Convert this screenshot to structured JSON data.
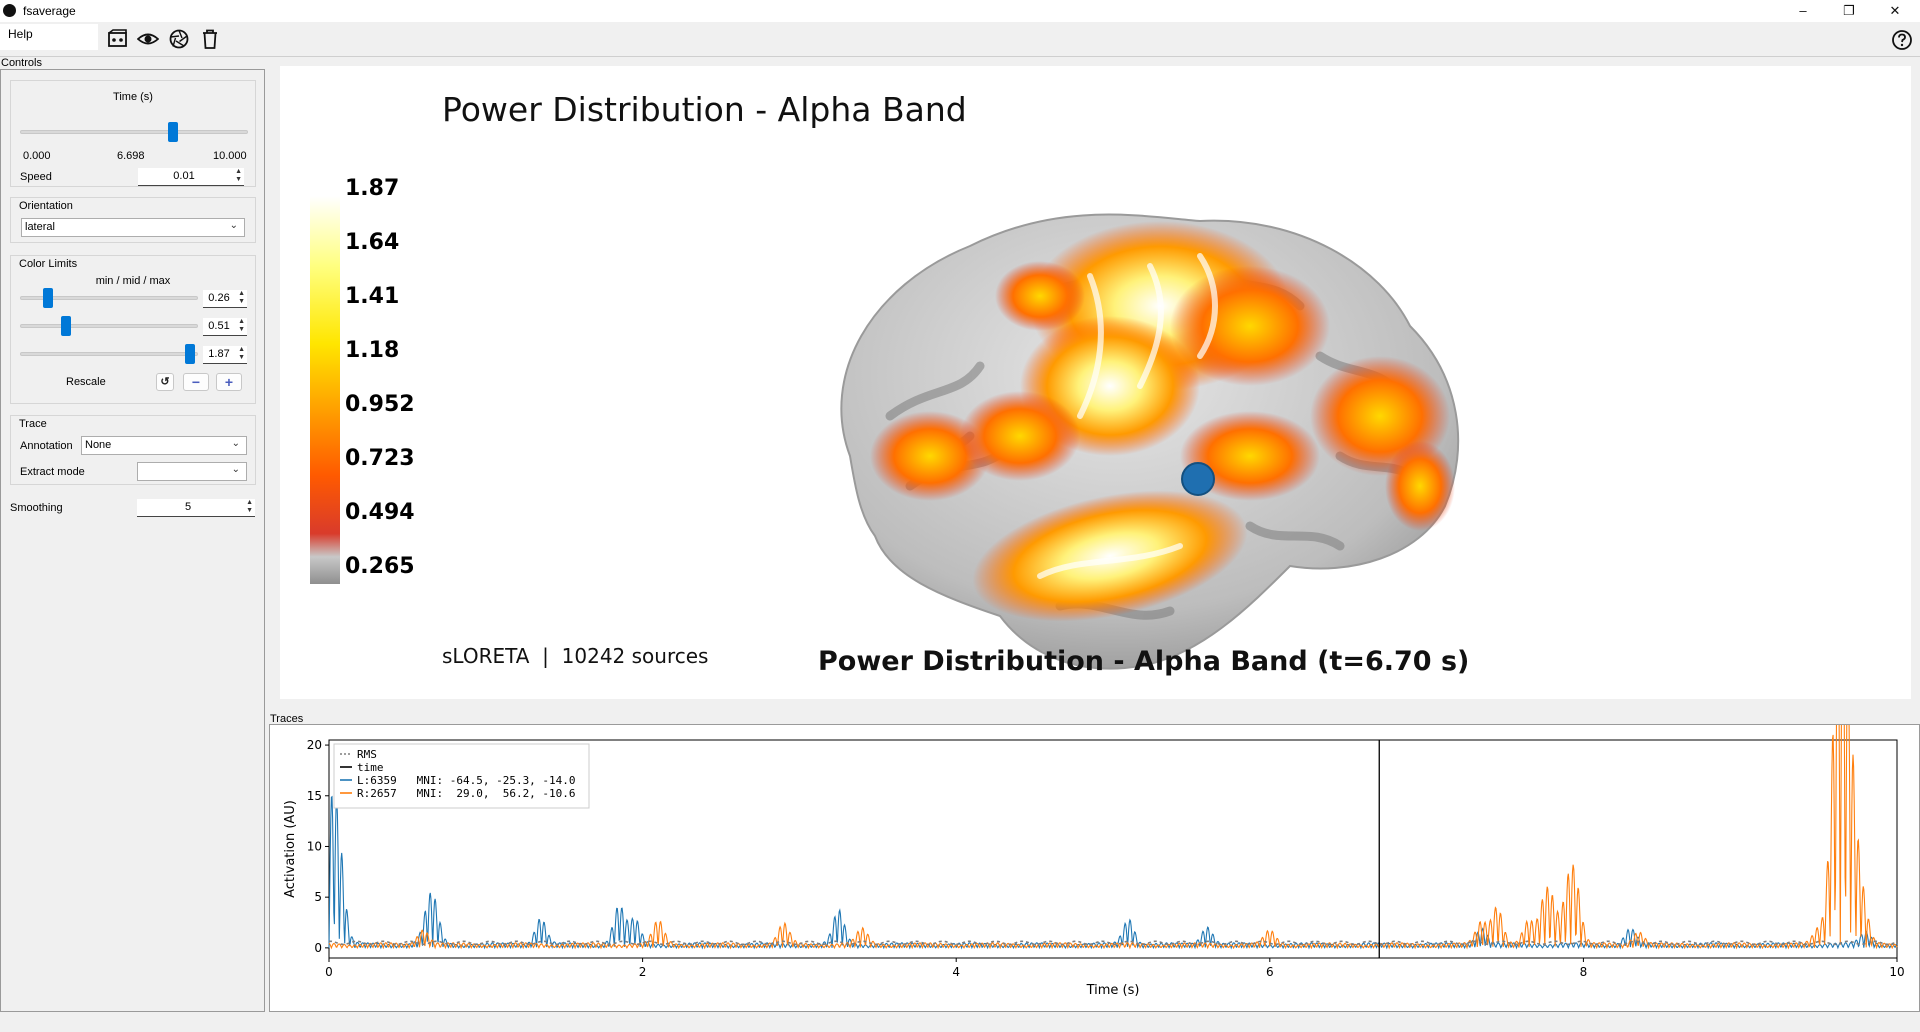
{
  "window": {
    "title": "fsaverage",
    "minimize": "–",
    "restore": "❐",
    "close": "✕"
  },
  "menu": {
    "help": "Help"
  },
  "toolbar": {
    "icons": [
      "movie-icon",
      "eye-icon",
      "camera-shutter-icon",
      "trash-icon",
      "help-circle-icon"
    ]
  },
  "controls": {
    "dock_title": "Controls",
    "time": {
      "label": "Time (s)",
      "min": "0.000",
      "current": "6.698",
      "max": "10.000",
      "fraction": 0.6698
    },
    "speed": {
      "label": "Speed",
      "value": "0.01"
    },
    "orientation": {
      "label": "Orientation",
      "value": "lateral"
    },
    "color_limits": {
      "label": "Color Limits",
      "sublabel": "min / mid / max",
      "min": "0.26",
      "mid": "0.51",
      "max": "1.87",
      "rescale_label": "Rescale",
      "reset_glyph": "↺",
      "minus_glyph": "−",
      "plus_glyph": "+"
    },
    "trace": {
      "label": "Trace",
      "annotation_label": "Annotation",
      "annotation_value": "None",
      "extract_label": "Extract mode",
      "extract_value": ""
    },
    "smoothing": {
      "label": "Smoothing",
      "value": "5"
    }
  },
  "view": {
    "title": "Power Distribution - Alpha Band",
    "colorbar_labels": [
      "1.87",
      "1.64",
      "1.41",
      "1.18",
      "0.952",
      "0.723",
      "0.494",
      "0.265"
    ],
    "footer_left": "sLORETA  |  10242 sources",
    "footer_center": "Power Distribution - Alpha Band (t=6.70 s)",
    "colors": {
      "accent": "#0078d7",
      "marker": "#1f6fb0"
    }
  },
  "traces": {
    "dock_title": "Traces"
  },
  "chart_data": {
    "type": "line",
    "xlabel": "Time (s)",
    "ylabel": "Activation (AU)",
    "xlim": [
      0,
      10
    ],
    "ylim": [
      -1,
      20.5
    ],
    "xticks": [
      "0",
      "2",
      "4",
      "6",
      "8",
      "10"
    ],
    "yticks": [
      "0",
      "5",
      "10",
      "15",
      "20"
    ],
    "time_marker": 6.698,
    "legend": [
      "RMS",
      "time",
      "L:6359   MNI: -64.5, -25.3, -14.0",
      "R:2657   MNI:  29.0,  56.2, -10.6"
    ],
    "series": [
      {
        "name": "L:6359   MNI: -64.5, -25.3, -14.0",
        "color": "#1f77b4",
        "peaks": [
          [
            0.02,
            12.8
          ],
          [
            0.07,
            6.5
          ],
          [
            0.63,
            2.5
          ],
          [
            0.67,
            3.4
          ],
          [
            1.35,
            2.6
          ],
          [
            1.85,
            3.8
          ],
          [
            1.95,
            2.4
          ],
          [
            3.25,
            3.3
          ],
          [
            5.1,
            2.5
          ],
          [
            5.6,
            1.8
          ],
          [
            7.35,
            1.6
          ],
          [
            8.3,
            1.5
          ],
          [
            9.8,
            1.2
          ]
        ]
      },
      {
        "name": "R:2657   MNI:  29.0,  56.2, -10.6",
        "color": "#ff7f0e",
        "peaks": [
          [
            0.6,
            1.5
          ],
          [
            2.1,
            2.3
          ],
          [
            2.9,
            2.0
          ],
          [
            3.4,
            1.5
          ],
          [
            6.0,
            1.3
          ],
          [
            7.35,
            2.2
          ],
          [
            7.45,
            3.8
          ],
          [
            7.65,
            2.2
          ],
          [
            7.75,
            3.7
          ],
          [
            7.8,
            3.5
          ],
          [
            7.9,
            4.8
          ],
          [
            7.95,
            5.4
          ],
          [
            8.35,
            1.3
          ],
          [
            9.5,
            1.5
          ],
          [
            9.6,
            13.5
          ],
          [
            9.64,
            20.0
          ],
          [
            9.68,
            14.5
          ],
          [
            9.72,
            8.5
          ],
          [
            9.78,
            4.0
          ]
        ]
      },
      {
        "name": "RMS",
        "color": "#7f7f7f",
        "level": 0.5
      }
    ]
  }
}
